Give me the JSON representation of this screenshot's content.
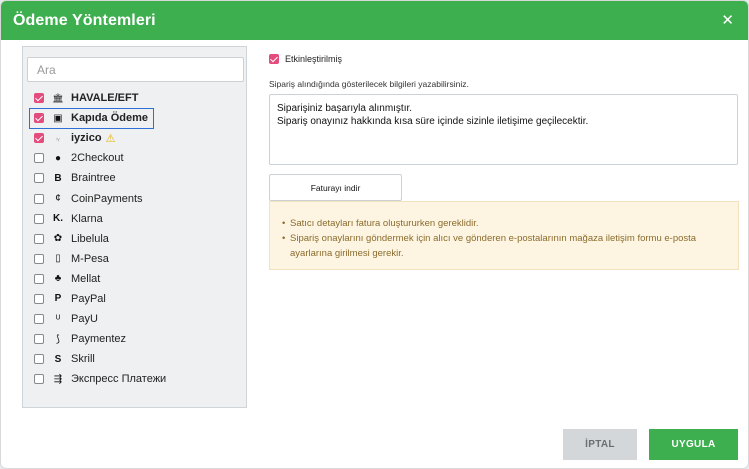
{
  "dialog": {
    "title": "Ödeme Yöntemleri",
    "close_glyph": "✕"
  },
  "left": {
    "search_placeholder": "Ara",
    "methods": [
      {
        "label": "HAVALE/EFT",
        "icon": "bank-icon",
        "checked": true,
        "bold": true
      },
      {
        "label": "Kapıda Ödeme",
        "icon": "cash-icon",
        "checked": true,
        "bold": true,
        "selected": true
      },
      {
        "label": "iyzico",
        "icon": "iyzico-logo-icon",
        "checked": true,
        "bold": true,
        "warning": true
      },
      {
        "label": "2Checkout",
        "icon": "2checkout-icon",
        "checked": false
      },
      {
        "label": "Braintree",
        "icon": "braintree-icon",
        "checked": false
      },
      {
        "label": "CoinPayments",
        "icon": "coinpayments-icon",
        "checked": false
      },
      {
        "label": "Klarna",
        "icon": "klarna-icon",
        "checked": false
      },
      {
        "label": "Libelula",
        "icon": "libelula-icon",
        "checked": false
      },
      {
        "label": "M-Pesa",
        "icon": "mpesa-icon",
        "checked": false
      },
      {
        "label": "Mellat",
        "icon": "mellat-icon",
        "checked": false
      },
      {
        "label": "PayPal",
        "icon": "paypal-icon",
        "checked": false
      },
      {
        "label": "PayU",
        "icon": "payu-icon",
        "checked": false
      },
      {
        "label": "Paymentez",
        "icon": "paymentez-icon",
        "checked": false
      },
      {
        "label": "Skrill",
        "icon": "skrill-icon",
        "checked": false
      },
      {
        "label": "Экспресс Платежи",
        "icon": "express-payments-icon",
        "checked": false
      }
    ],
    "warning_glyph": "⚠"
  },
  "right": {
    "enabled_label": "Etkinleştirilmiş",
    "hint": "Sipariş alındığında gösterilecek bilgileri yazabilirsiniz.",
    "message_line1": "Siparişiniz başarıyla alınmıştır.",
    "message_line2": "Sipariş onayınız hakkında kısa süre içinde sizinle iletişime geçilecektir.",
    "invoice_button": "Faturayı indir",
    "notices": [
      "Satıcı detayları fatura oluştururken gereklidir.",
      "Sipariş onaylarını göndermek için alıcı ve gönderen e-postalarının mağaza iletişim formu e-posta ayarlarına girilmesi gerekir."
    ]
  },
  "footer": {
    "cancel_label": "İPTAL",
    "apply_label": "UYGULA"
  },
  "colors": {
    "header": "#3eaf4f",
    "checkbox": "#e34c7d",
    "selection": "#2d6fd6",
    "notice_bg": "#fdf5e1",
    "notice_text": "#8a6b2c"
  }
}
